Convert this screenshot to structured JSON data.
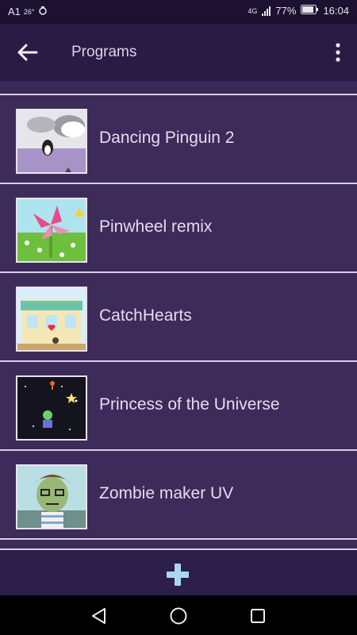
{
  "status_bar": {
    "carrier": "A1",
    "temperature": "26°",
    "network": "4G",
    "battery": "77%",
    "time": "16:04"
  },
  "app_bar": {
    "title": "Programs",
    "back_icon": "arrow-left-icon",
    "menu_icon": "more-vertical-icon"
  },
  "programs": [
    {
      "name": "Dancing Pinguin 2"
    },
    {
      "name": "Pinwheel remix"
    },
    {
      "name": "CatchHearts"
    },
    {
      "name": "Princess of the Universe"
    },
    {
      "name": "Zombie maker UV"
    },
    {
      "name": ""
    }
  ],
  "bottom_bar": {
    "add_icon": "plus-icon"
  },
  "nav_bar": {
    "back_icon": "triangle-back-icon",
    "home_icon": "circle-home-icon",
    "recents_icon": "square-recents-icon"
  },
  "colors": {
    "background": "#3d2b59",
    "app_bar": "#2a1b45",
    "divider": "#d9cde8",
    "text": "#e6dcf1",
    "accent": "#a9d7ef"
  }
}
